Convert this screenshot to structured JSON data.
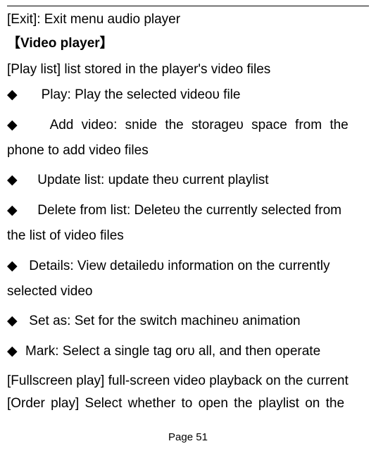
{
  "top": {
    "exit_label": "[Exit]: ",
    "exit_text": "Exit menu audio player"
  },
  "heading": {
    "open_bracket": "【",
    "title": "Video player",
    "close_bracket": "】"
  },
  "playlist": {
    "label": "[Play list] ",
    "text": "list stored in the player's video files"
  },
  "items": {
    "play_label": "Play: ",
    "play_text": "Play the selected videoυ file",
    "addvideo_label": "Add video: ",
    "addvideo_text1": "snide the storageυ space from the",
    "addvideo_text2": "phone to add video files",
    "update_label": "Update list: ",
    "update_text": "update theυ current playlist",
    "delete_label": "Delete from list: ",
    "delete_text1": "Deleteυ the currently selected from",
    "delete_text2": "the list of video files",
    "details_label": "Details: ",
    "details_text1": "View detailedυ information on the currently",
    "details_text2": "selected video",
    "setas_label": "Set as: ",
    "setas_text": "Set for the switch machineυ animation",
    "mark_label": "Mark: ",
    "mark_text": "Select a single tag orυ all, and then operate"
  },
  "fullscreen": {
    "label": "[Fullscreen play] ",
    "text": "full-screen video playback on the current"
  },
  "order": {
    "label": "[Order play] ",
    "text": "Select whether to open the playlist on the"
  },
  "page_number": "Page 51",
  "diamond": "◆"
}
